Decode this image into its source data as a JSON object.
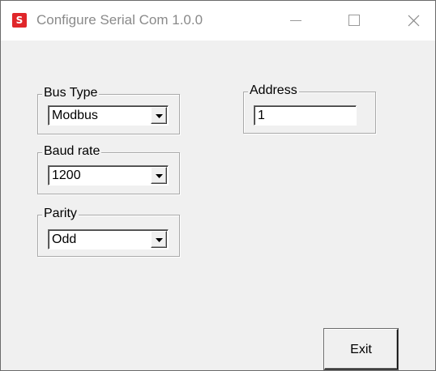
{
  "window": {
    "title": "Configure Serial Com 1.0.0",
    "icon": "app-s-logo-icon",
    "icon_letter": "S",
    "accent_color": "#e0262a"
  },
  "bus_type": {
    "label": "Bus Type",
    "selected": "Modbus"
  },
  "baud_rate": {
    "label": "Baud rate",
    "selected": "1200"
  },
  "parity": {
    "label": "Parity",
    "selected": "Odd"
  },
  "address": {
    "label": "Address",
    "value": "1"
  },
  "buttons": {
    "exit_label": "Exit"
  }
}
